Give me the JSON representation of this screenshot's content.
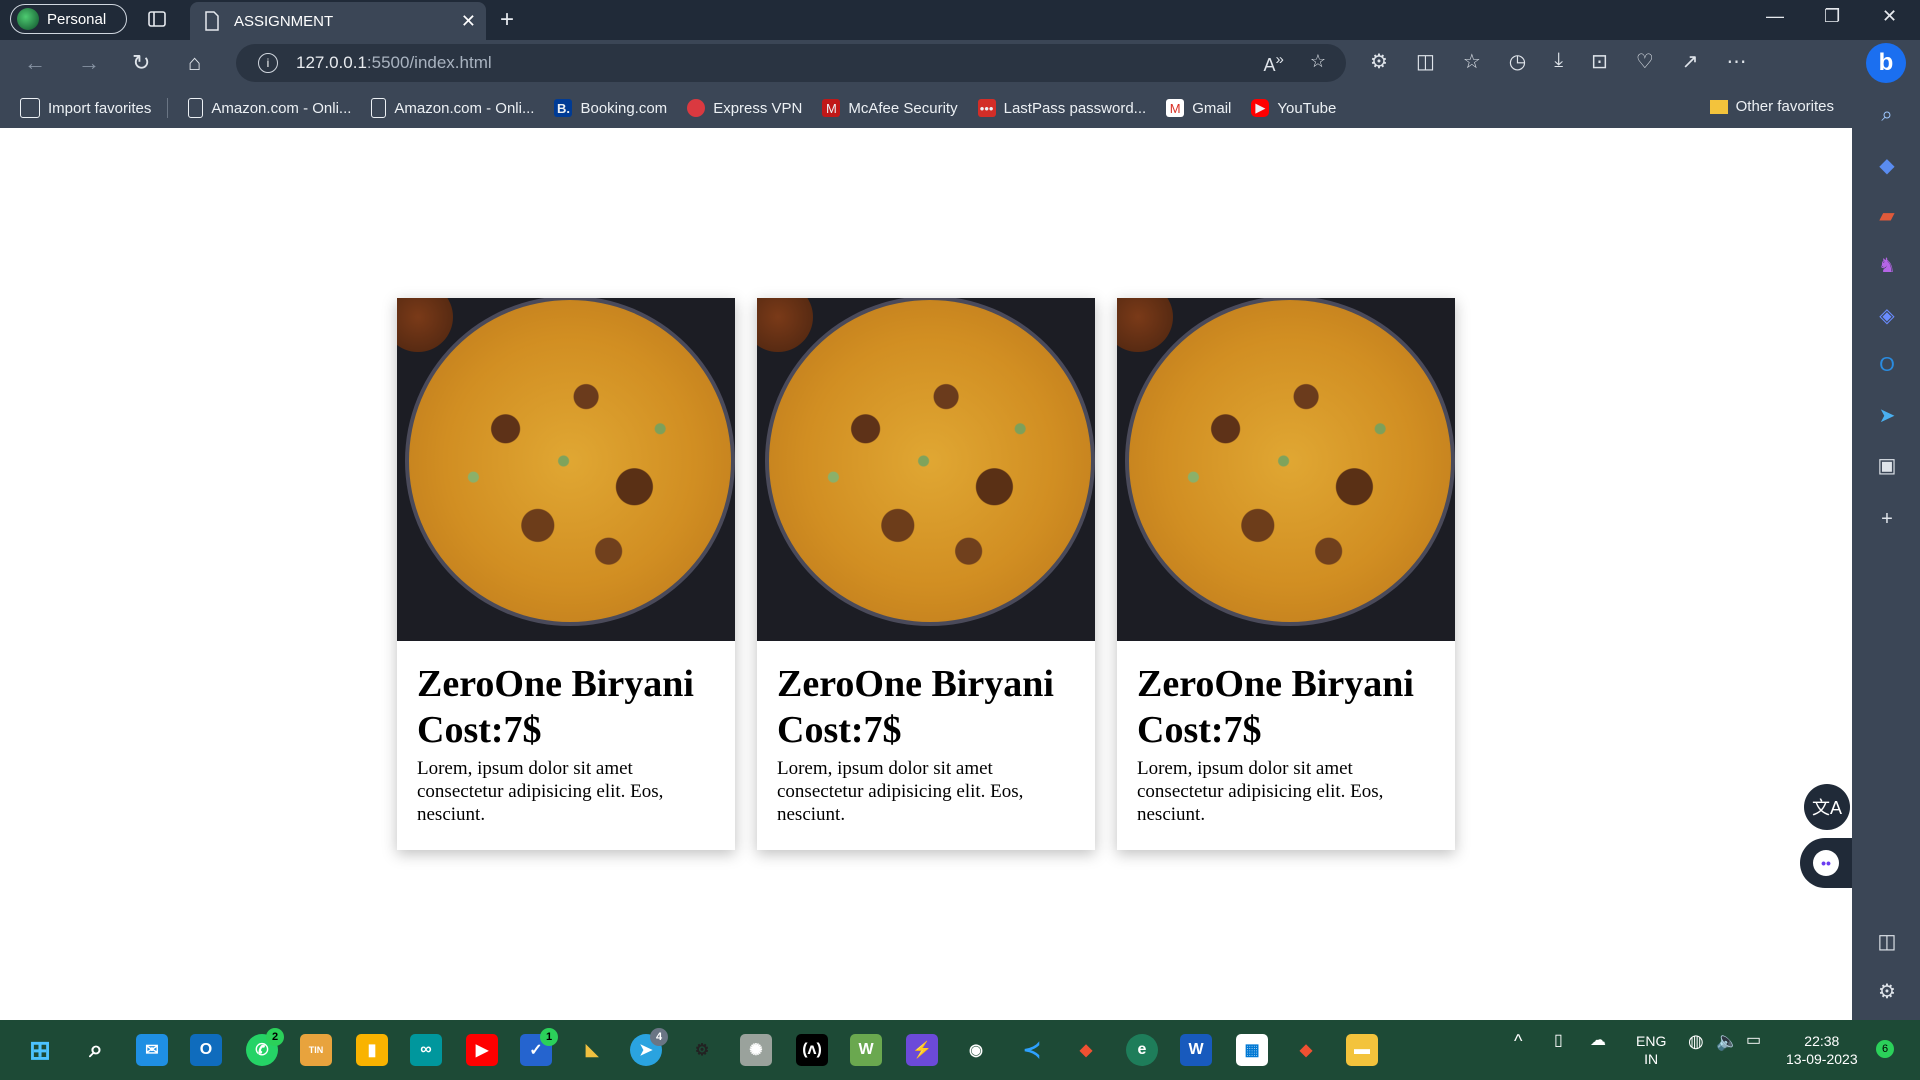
{
  "browser": {
    "profile_label": "Personal",
    "tab_title": "ASSIGNMENT",
    "url_host": "127.0.0.1",
    "url_path": ":5500/index.html"
  },
  "favorites": {
    "items": [
      {
        "label": "Import favorites",
        "icon": "import-icon"
      },
      {
        "label": "Amazon.com - Onli...",
        "icon": "page-icon"
      },
      {
        "label": "Amazon.com - Onli...",
        "icon": "page-icon"
      },
      {
        "label": "Booking.com",
        "icon": "booking-icon"
      },
      {
        "label": "Express VPN",
        "icon": "vpn-icon"
      },
      {
        "label": "McAfee Security",
        "icon": "mcafee-icon"
      },
      {
        "label": "LastPass password...",
        "icon": "lastpass-icon"
      },
      {
        "label": "Gmail",
        "icon": "gmail-icon"
      },
      {
        "label": "YouTube",
        "icon": "youtube-icon"
      }
    ],
    "other_label": "Other favorites"
  },
  "cards": [
    {
      "title": "ZeroOne Biryani Cost:7$",
      "description": "Lorem, ipsum dolor sit amet consectetur adipisicing elit. Eos, nesciunt."
    },
    {
      "title": "ZeroOne Biryani Cost:7$",
      "description": "Lorem, ipsum dolor sit amet consectetur adipisicing elit. Eos, nesciunt."
    },
    {
      "title": "ZeroOne Biryani Cost:7$",
      "description": "Lorem, ipsum dolor sit amet consectetur adipisicing elit. Eos, nesciunt."
    }
  ],
  "taskbar": {
    "badges": {
      "whatsapp": "2",
      "todo": "1",
      "telegram": "4",
      "notifications": "6"
    },
    "language_line1": "ENG",
    "language_line2": "IN",
    "time": "22:38",
    "date": "13-09-2023"
  },
  "colors": {
    "titlebar": "#202a38",
    "toolbar": "#3b4656",
    "taskbar": "#1d4a36"
  }
}
